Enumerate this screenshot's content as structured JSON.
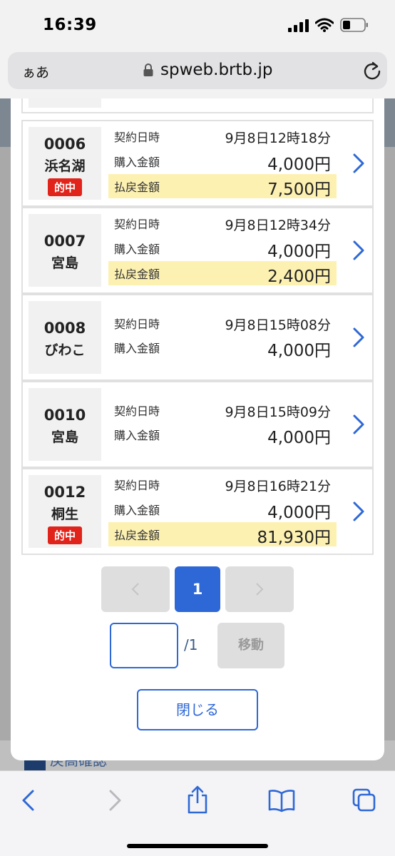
{
  "status_bar": {
    "time": "16:39"
  },
  "url_bar": {
    "aa_label": "ぁあ",
    "url": "spweb.brtb.jp"
  },
  "background": {
    "partial_text": "戻高確認"
  },
  "labels": {
    "contract_datetime": "契約日時",
    "purchase_amount": "購入金額",
    "payout_amount": "払戻金額",
    "hit_badge": "的中"
  },
  "records": [
    {
      "id": "0006",
      "place": "浜名湖",
      "hit": true,
      "datetime": "9月8日12時18分",
      "purchase": "4,000円",
      "payout": "7,500円"
    },
    {
      "id": "0007",
      "place": "宮島",
      "hit": false,
      "datetime": "9月8日12時34分",
      "purchase": "4,000円",
      "payout": "2,400円"
    },
    {
      "id": "0008",
      "place": "びわこ",
      "hit": false,
      "datetime": "9月8日15時08分",
      "purchase": "4,000円",
      "payout": ""
    },
    {
      "id": "0010",
      "place": "宮島",
      "hit": false,
      "datetime": "9月8日15時09分",
      "purchase": "4,000円",
      "payout": ""
    },
    {
      "id": "0012",
      "place": "桐生",
      "hit": true,
      "datetime": "9月8日16時21分",
      "purchase": "4,000円",
      "payout": "81,930円"
    }
  ],
  "pagination": {
    "current": "1",
    "total": "/1",
    "move_label": "移動",
    "input_value": ""
  },
  "close_label": "閉じる",
  "colors": {
    "accent": "#2e68d6",
    "hit_badge": "#e0241b",
    "payout_highlight": "#fdf1b2"
  }
}
